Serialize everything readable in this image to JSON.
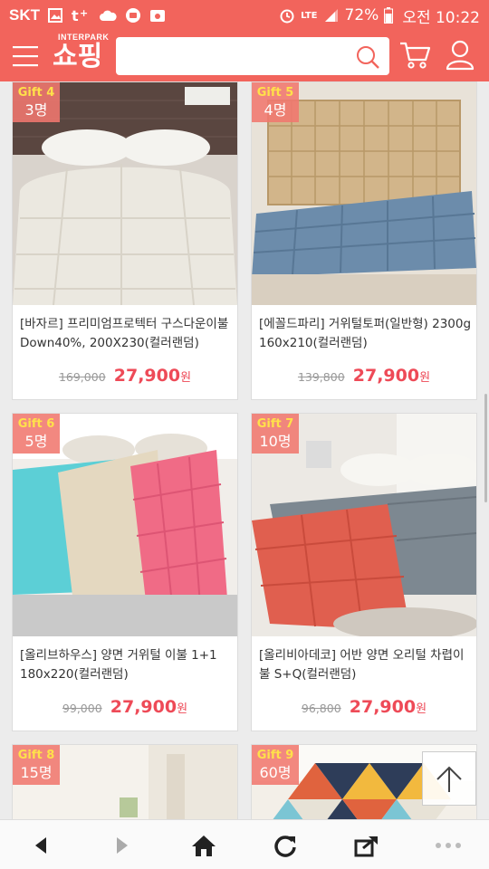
{
  "status_bar": {
    "carrier": "SKT",
    "network": "LTE",
    "battery": "72%",
    "time": "오전 10:22"
  },
  "header": {
    "logo_small": "INTERPARK",
    "logo_big": "쇼핑",
    "search_placeholder": ""
  },
  "products": [
    {
      "gift_label": "Gift 4",
      "gift_count": "3명",
      "title": "[바자르] 프리미엄프로텍터 구스다운이불 Down40%, 200X230(컬러랜덤)",
      "original_price": "169,000",
      "sale_price": "27,900",
      "currency": "원"
    },
    {
      "gift_label": "Gift 5",
      "gift_count": "4명",
      "title": "[에꼴드파리] 거위털토퍼(일반형) 2300g 160x210(컬러랜덤)",
      "original_price": "139,800",
      "sale_price": "27,900",
      "currency": "원"
    },
    {
      "gift_label": "Gift 6",
      "gift_count": "5명",
      "title": "[올리브하우스] 양면 거위털 이불 1+1 180x220(컬러랜덤)",
      "original_price": "99,000",
      "sale_price": "27,900",
      "currency": "원"
    },
    {
      "gift_label": "Gift 7",
      "gift_count": "10명",
      "title": "[올리비아데코] 어반 양면 오리털 차렵이불 S+Q(컬러랜덤)",
      "original_price": "96,800",
      "sale_price": "27,900",
      "currency": "원"
    },
    {
      "gift_label": "Gift 8",
      "gift_count": "15명"
    },
    {
      "gift_label": "Gift 9",
      "gift_count": "60명"
    }
  ],
  "colors": {
    "brand": "#f2645c",
    "sale_price": "#ee4a57",
    "gift_count_text": "#ffe14a"
  }
}
